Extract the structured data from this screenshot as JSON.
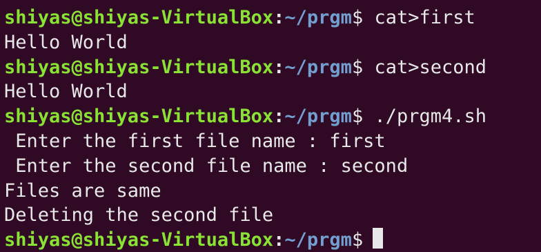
{
  "terminal": {
    "prompt": {
      "user_host": "shiyas@shiyas-VirtualBox",
      "colon": ":",
      "path": "~/prgm",
      "dollar": "$"
    },
    "lines": [
      {
        "type": "command",
        "text": " cat>first"
      },
      {
        "type": "output",
        "text": "Hello World"
      },
      {
        "type": "command",
        "text": " cat>second"
      },
      {
        "type": "output",
        "text": "Hello World"
      },
      {
        "type": "command",
        "text": " ./prgm4.sh"
      },
      {
        "type": "output",
        "text": " Enter the first file name : first"
      },
      {
        "type": "output",
        "text": " Enter the second file name : second"
      },
      {
        "type": "output",
        "text": "Files are same"
      },
      {
        "type": "output",
        "text": "Deleting the second file"
      },
      {
        "type": "prompt_only",
        "text": ""
      }
    ],
    "colors": {
      "background": "#300a24",
      "user_host": "#8ae234",
      "path": "#729fcf",
      "text": "#e8e8e8"
    }
  }
}
